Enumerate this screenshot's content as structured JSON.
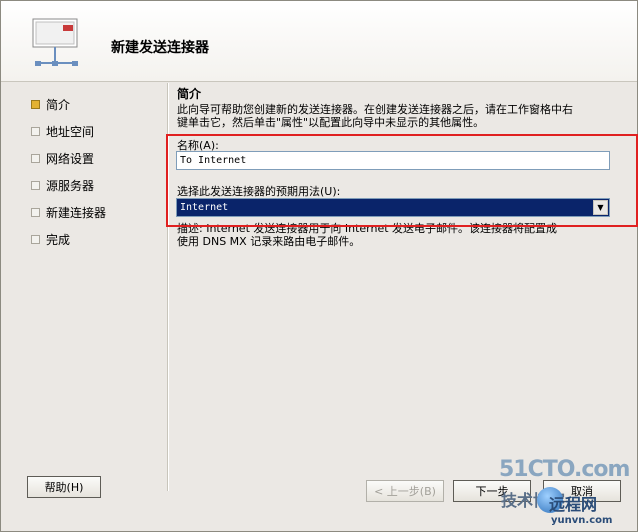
{
  "header": {
    "title": "新建发送连接器"
  },
  "nav": {
    "items": [
      {
        "label": "简介",
        "active": true
      },
      {
        "label": "地址空间",
        "active": false
      },
      {
        "label": "网络设置",
        "active": false
      },
      {
        "label": "源服务器",
        "active": false
      },
      {
        "label": "新建连接器",
        "active": false
      },
      {
        "label": "完成",
        "active": false
      }
    ]
  },
  "main": {
    "section_title": "简介",
    "intro_line1": "此向导可帮助您创建新的发送连接器。在创建发送连接器之后，请在工作窗格中右",
    "intro_line2": "键单击它，然后单击\"属性\"以配置此向导中未显示的其他属性。",
    "name_label": "名称(A):",
    "name_value": "To Internet",
    "usage_label": "选择此发送连接器的预期用法(U):",
    "usage_value": "Internet",
    "desc_line1": "描述: Internet 发送连接器用于向 Internet 发送电子邮件。该连接器将配置成",
    "desc_line2": "使用 DNS MX 记录来路由电子邮件。"
  },
  "buttons": {
    "help": "帮助(H)",
    "back": "< 上一步(B)",
    "next": "下一步",
    "cancel": "取消"
  },
  "watermark": {
    "line1": "51CTO.com",
    "line2": "技术博客",
    "line3": "远程网",
    "line4": "yunvn.com"
  },
  "colors": {
    "highlight_border": "#e02020",
    "select_bg": "#0a246a",
    "active_bullet": "#e2b233"
  }
}
